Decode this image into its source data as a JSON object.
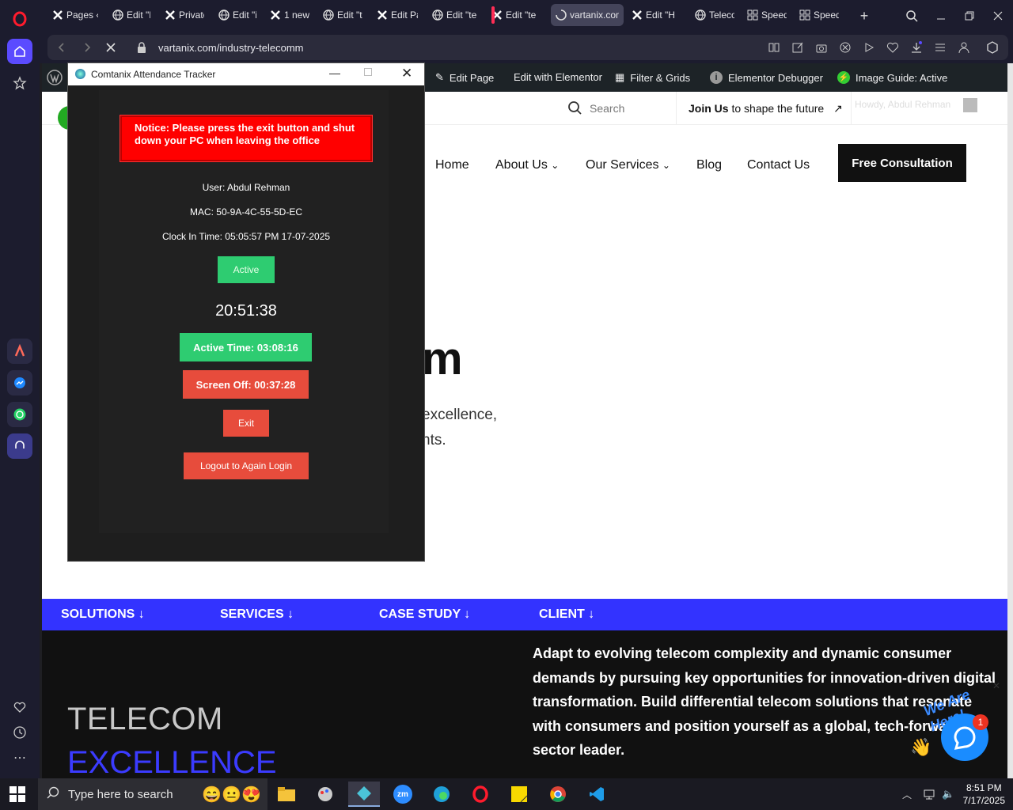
{
  "browser": {
    "tabs": [
      {
        "label": "Pages ‹",
        "icon": "x-icon"
      },
      {
        "label": "Edit \"El",
        "icon": "globe-icon"
      },
      {
        "label": "Private",
        "icon": "x-icon"
      },
      {
        "label": "Edit \"in",
        "icon": "globe-icon"
      },
      {
        "label": "1 new",
        "icon": "x-icon"
      },
      {
        "label": "Edit \"te",
        "icon": "globe-icon"
      },
      {
        "label": "Edit Pa",
        "icon": "x-icon"
      },
      {
        "label": "Edit \"te",
        "icon": "globe-icon"
      },
      {
        "label": "Edit \"te",
        "icon": "x-icon"
      },
      {
        "label": "vartanix.com/",
        "icon": "loading-icon",
        "active": true
      },
      {
        "label": "Edit \"H",
        "icon": "x-icon"
      },
      {
        "label": "Telecor",
        "icon": "globe-icon"
      },
      {
        "label": "Speed",
        "icon": "grid-icon"
      },
      {
        "label": "Speed",
        "icon": "grid-icon"
      }
    ],
    "url": "vartanix.com/industry-telecomm"
  },
  "wp_admin_bar": {
    "items": [
      "Edit Page",
      "Edit with Elementor",
      "Filter & Grids",
      "Elementor Debugger",
      "Image Guide: Active"
    ],
    "howdy": "Howdy, Abdul Rehman"
  },
  "site": {
    "search_placeholder": "Search",
    "join_bold": "Join Us",
    "join_rest": "to shape the future",
    "nav": [
      "Home",
      "About Us",
      "Our Services",
      "Blog",
      "Contact Us"
    ],
    "cta": "Free Consultation",
    "hero_fragment": "m",
    "hero_line1": "excellence,",
    "hero_line2": "nts.",
    "band": [
      "SOLUTIONS",
      "SERVICES",
      "CASE STUDY",
      "CLIENT"
    ],
    "telecom": "TELECOM",
    "excellence": "EXCELLENCE",
    "adapt": "Adapt to evolving telecom complexity and dynamic consumer demands by pursuing key opportunities for innovation-driven digital transformation. Build differential telecom solutions that resonate with consumers and position yourself as a global, tech-forward sector leader.",
    "chat_badge": "1",
    "chat_greeting": "We Are Here!"
  },
  "tracker": {
    "title": "Comtanix Attendance Tracker",
    "notice": "Notice: Please press the exit button and shut down your PC when leaving the office",
    "user": "User: Abdul Rehman",
    "mac": "MAC: 50-9A-4C-55-5D-EC",
    "clock_in": "Clock In Time: 05:05:57 PM 17-07-2025",
    "status": "Active",
    "time": "20:51:38",
    "active_time": "Active Time: 03:08:16",
    "screen_off": "Screen Off: 00:37:28",
    "exit": "Exit",
    "logout": "Logout to Again Login"
  },
  "taskbar": {
    "search_placeholder": "Type here to search",
    "time": "8:51 PM",
    "date": "7/17/2025"
  },
  "colors": {
    "accent_blue": "#3333ff",
    "tracker_green": "#2ecc71",
    "tracker_red": "#e74c3c",
    "notice_red": "#ff0000"
  }
}
